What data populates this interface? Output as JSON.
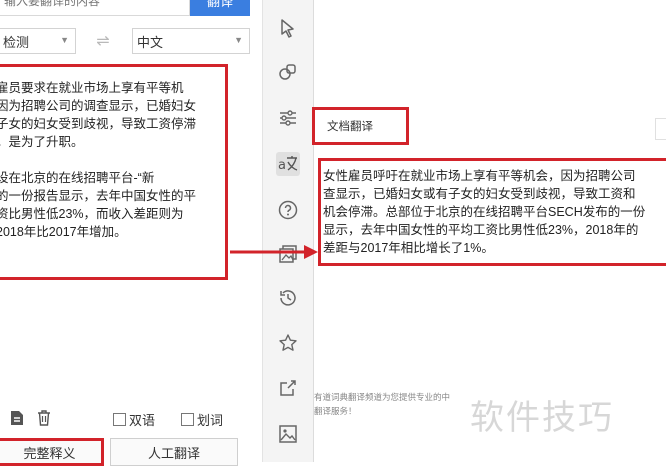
{
  "left": {
    "search_placeholder": "输入要翻译的内容",
    "translate_button": "翻译",
    "source_lang": "检测",
    "target_lang": "中文",
    "source_paragraphs": [
      "雇员要求在就业市场上享有平等机\n因为招聘公司的调查显示，已婚妇女\n子女的妇女受到歧视，导致工资停滞\n。是为了升职。",
      "设在北京的在线招聘平台-“新\n的一份报告显示，去年中国女性的平\n资比男性低23%，而收入差距则为\n2018年比2017年增加。"
    ],
    "checkbox_bilingual": "双语",
    "checkbox_word": "划词",
    "mode_full": "完整释义",
    "mode_human": "人工翻译"
  },
  "right": {
    "doc_tab_label": "文档翻译",
    "result_lines": [
      "女性雇员呼吁在就业市场上享有平等机会，因为招聘公司",
      "查显示，已婚妇女或有子女的妇女受到歧视，导致工资和",
      "机会停滞。总部位于北京的在线招聘平台SECH发布的一份",
      "显示，去年中国女性的平均工资比男性低23%，2018年的",
      "差距与2017年相比增长了1%。"
    ],
    "promo_lines": [
      "有道词典翻译频道为您提供专业的中",
      "翻译服务！"
    ],
    "watermark": "软件技巧"
  },
  "icons": {
    "pointer": "cursor-icon",
    "eraser": "eraser-icon",
    "settings": "sliders-icon",
    "translate": "translate-icon",
    "help": "help-icon",
    "gallery": "gallery-icon",
    "history": "history-icon",
    "star": "star-icon",
    "share": "share-icon",
    "image": "image-icon"
  },
  "colors": {
    "highlight_red": "#d2232a",
    "accent_blue": "#3a7ee0"
  }
}
